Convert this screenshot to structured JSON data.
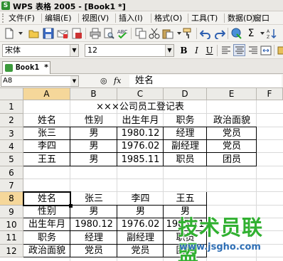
{
  "window": {
    "title": "WPS 表格 2005 - [Book1 *]"
  },
  "menu": [
    "文件(F)",
    "编辑(E)",
    "视图(V)",
    "插入(I)",
    "格式(O)",
    "工具(T)",
    "数据(D)",
    "窗口(W)"
  ],
  "toolbar": {
    "standard_icons": [
      "new-icon",
      "open-icon",
      "save-icon",
      "print-icon",
      "print-preview-icon",
      "spellcheck-icon",
      "copy-icon",
      "cut-icon",
      "paste-icon",
      "format-painter-icon",
      "undo-icon",
      "redo-icon",
      "hyperlink-icon",
      "autosum-icon",
      "sort-icon"
    ],
    "autosum_label": "Σ",
    "font_name": "宋体",
    "font_size": "12",
    "bold": "B",
    "italic": "I",
    "underline": "U"
  },
  "tabs": [
    {
      "label": "Book1 *"
    }
  ],
  "formula_bar": {
    "cell_ref": "A8",
    "fx": "fx",
    "value": "姓名"
  },
  "columns": [
    "A",
    "B",
    "C",
    "D",
    "E",
    "F"
  ],
  "rows": [
    "1",
    "2",
    "3",
    "4",
    "5",
    "6",
    "7",
    "8",
    "9",
    "10",
    "11",
    "12"
  ],
  "sheet": {
    "title": "×××公司员工登记表",
    "header_row": [
      "姓名",
      "性别",
      "出生年月",
      "职务",
      "政治面貌"
    ],
    "records": [
      [
        "张三",
        "男",
        "1980.12",
        "经理",
        "党员"
      ],
      [
        "李四",
        "男",
        "1976.02",
        "副经理",
        "党员"
      ],
      [
        "王五",
        "男",
        "1985.11",
        "职员",
        "团员"
      ]
    ],
    "transposed": [
      [
        "姓名",
        "张三",
        "李四",
        "王五"
      ],
      [
        "性别",
        "男",
        "男",
        "男"
      ],
      [
        "出生年月",
        "1980.12",
        "1976.02",
        "1985.11"
      ],
      [
        "职务",
        "经理",
        "副经理",
        "职员"
      ],
      [
        "政治面貌",
        "党员",
        "党员",
        "团员"
      ]
    ]
  },
  "watermark": {
    "brand": "技术员联盟",
    "url": "www.jsgho.com"
  }
}
